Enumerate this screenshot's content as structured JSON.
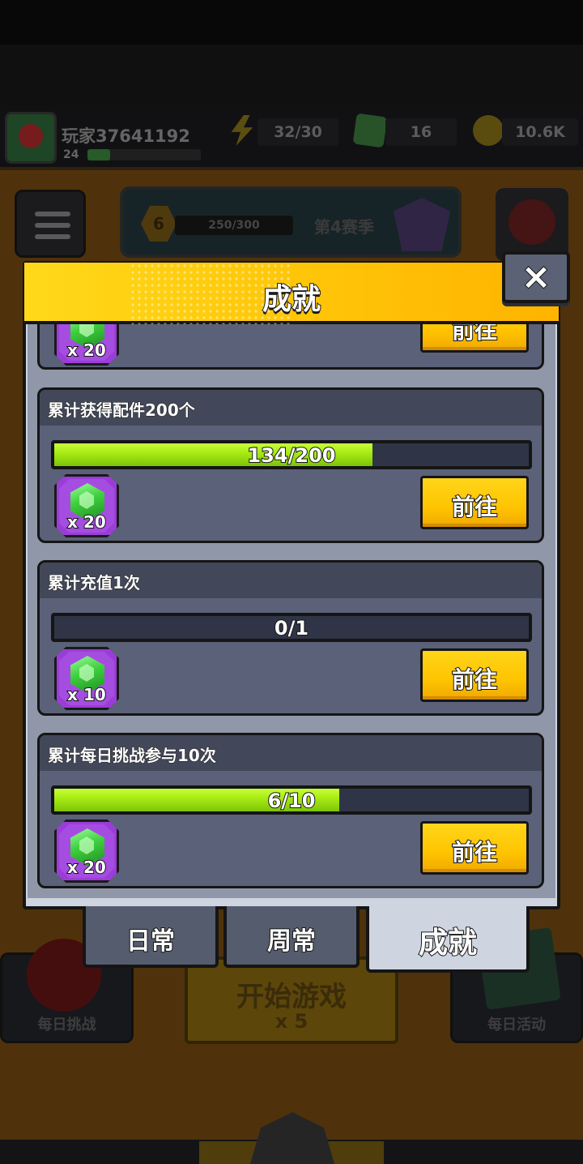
{
  "background": {
    "player_name": "玩家37641192",
    "player_level": "24",
    "xp_progress": 0.2,
    "energy": "32/30",
    "gems": "16",
    "coins": "10.6K",
    "season_level": "6",
    "season_progress": "250/300",
    "season_name": "第4赛季",
    "daily_challenge_label": "每日挑战",
    "start_game_label": "开始游戏",
    "start_game_cost": "x 5",
    "daily_activity_label": "每日活动"
  },
  "dialog": {
    "title": "成就",
    "close_label": "×",
    "go_label": "前往",
    "top_partial": {
      "reward_count": "x 20"
    },
    "achievements": [
      {
        "title": "累计获得配件200个",
        "progress_text": "134/200",
        "current": 134,
        "target": 200,
        "reward_count": "x 20"
      },
      {
        "title": "累计充值1次",
        "progress_text": "0/1",
        "current": 0,
        "target": 1,
        "reward_count": "x 10"
      },
      {
        "title": "累计每日挑战参与10次",
        "progress_text": "6/10",
        "current": 6,
        "target": 10,
        "reward_count": "x 20"
      }
    ],
    "tabs": [
      {
        "label": "日常",
        "active": false
      },
      {
        "label": "周常",
        "active": false
      },
      {
        "label": "成就",
        "active": true
      }
    ]
  },
  "colors": {
    "header_yellow": "#ffc80a",
    "progress_green": "#a8ec14",
    "button_yellow": "#ffc400",
    "reward_purple": "#a54de0",
    "card_slate": "#5a6178"
  }
}
